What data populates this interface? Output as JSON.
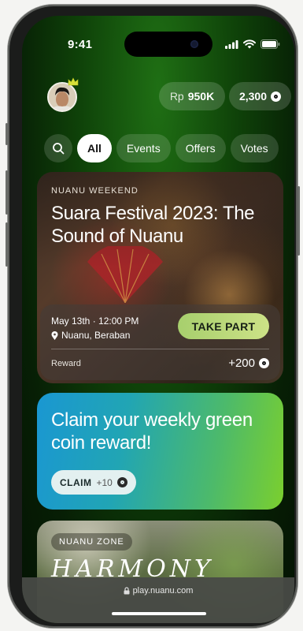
{
  "status_bar": {
    "time": "9:41"
  },
  "header": {
    "balance_prefix": "Rp",
    "balance_value": "950K",
    "coins": "2,300"
  },
  "tabs": [
    {
      "label": "All",
      "active": true
    },
    {
      "label": "Events",
      "active": false
    },
    {
      "label": "Offers",
      "active": false
    },
    {
      "label": "Votes",
      "active": false
    }
  ],
  "event": {
    "kicker": "NUANU WEEKEND",
    "title": "Suara Festival 2023: The Sound of Nuanu",
    "date": "May 13th · 12:00 PM",
    "location": "Nuanu, Beraban",
    "cta": "TAKE PART",
    "reward_label": "Reward",
    "reward_value": "+200"
  },
  "claim": {
    "title": "Claim your weekly green coin reward!",
    "button_label": "CLAIM",
    "amount": "+10"
  },
  "zone": {
    "tag": "NUANU ZONE",
    "title": "HARMONY"
  },
  "browser": {
    "url": "play.nuanu.com"
  },
  "colors": {
    "screen_bg": "#0f4309",
    "take_part": "#b5d878",
    "claim_gradient_start": "#1a97d2",
    "claim_gradient_end": "#7bcf2e"
  }
}
